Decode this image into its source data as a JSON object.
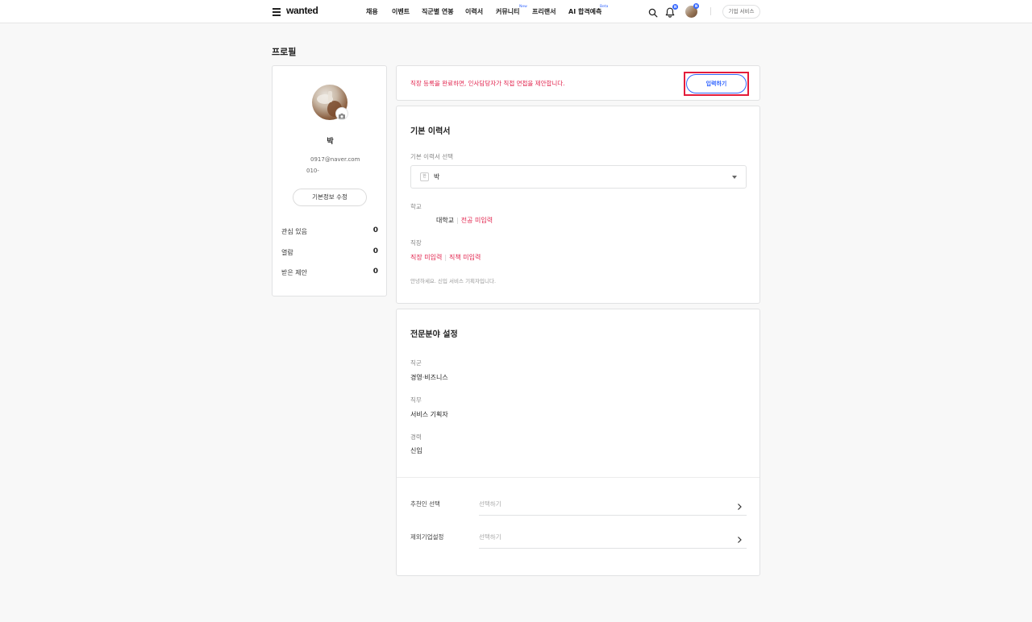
{
  "header": {
    "logo": "wanted",
    "nav": [
      {
        "label": "채용"
      },
      {
        "label": "이벤트"
      },
      {
        "label": "직군별 연봉"
      },
      {
        "label": "이력서"
      },
      {
        "label": "커뮤니티",
        "sup": "New"
      },
      {
        "label": "프리랜서"
      },
      {
        "label": "AI 합격예측",
        "sup": "Beta"
      }
    ],
    "notification_badge": "N",
    "avatar_badge": "N",
    "corp_service": "기업 서비스",
    "icons": [
      "menu-icon",
      "search-icon",
      "bell-icon"
    ]
  },
  "page_title": "프로필",
  "profile": {
    "name": "박",
    "email": "0917@naver.com",
    "phone": "010-",
    "edit_button": "기본정보 수정",
    "stats": [
      {
        "label": "관심 있음",
        "value": "0"
      },
      {
        "label": "열람",
        "value": "0"
      },
      {
        "label": "받은 제안",
        "value": "0"
      }
    ]
  },
  "notice": {
    "text": "직장 등록을 완료하면, 인사담당자가 직접 면접을 제안합니다.",
    "button": "입력하기"
  },
  "resume": {
    "title": "기본 이력서",
    "select_label": "기본 이력서 선택",
    "select_icon": "한",
    "selected": "박",
    "school_label": "학교",
    "school_name": "대학교",
    "school_major": "전공 미입력",
    "work_label": "직장",
    "work_company": "직장 미입력",
    "work_position": "직책 미입력",
    "intro": "안녕하세요. 신입 서비스 기획자입니다."
  },
  "specialty": {
    "title": "전문분야 설정",
    "job_group_label": "직군",
    "job_group": "경영·비즈니스",
    "job_label": "직무",
    "job": "서비스 기획자",
    "career_label": "경력",
    "career": "신입",
    "recommender_label": "추천인 선택",
    "recommender_placeholder": "선택하기",
    "excluded_label": "제외기업설정",
    "excluded_placeholder": "선택하기"
  },
  "colors": {
    "accent": "#3366ff",
    "alert": "#e2234d",
    "highlight": "#e41c3b"
  }
}
